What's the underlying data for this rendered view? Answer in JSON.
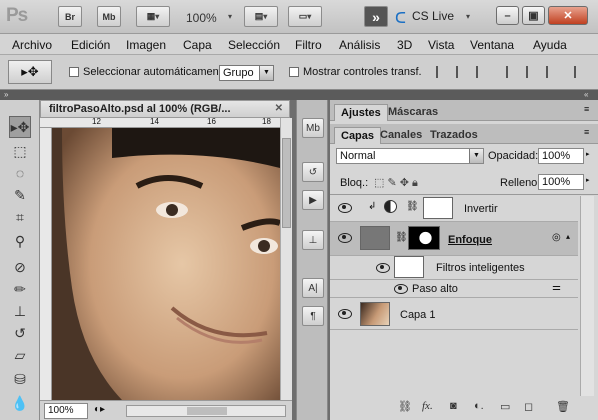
{
  "app": {
    "logo": "Ps",
    "bridge_btn": "Br",
    "minibridge_btn": "Mb",
    "zoom": "100%",
    "cslive": "CS Live",
    "workspace_arrow": "»"
  },
  "menu": [
    "Archivo",
    "Edición",
    "Imagen",
    "Capa",
    "Selección",
    "Filtro",
    "Análisis",
    "3D",
    "Vista",
    "Ventana",
    "Ayuda"
  ],
  "options": {
    "auto_select_label": "Seleccionar automáticamente:",
    "auto_select_value": "Grupo",
    "transform_label": "Mostrar controles transf."
  },
  "document": {
    "tab_title": "filtroPasoAlto.psd al 100% (RGB/...",
    "ruler_ticks": [
      "12",
      "14",
      "16",
      "18"
    ],
    "zoom_status": "100%"
  },
  "panels": {
    "top_tabs": [
      "Ajustes",
      "Máscaras"
    ],
    "layer_tabs": [
      "Capas",
      "Canales",
      "Trazados"
    ],
    "blend_mode": "Normal",
    "opacity_label": "Opacidad:",
    "opacity_value": "100%",
    "lock_label": "Bloq.:",
    "fill_label": "Relleno:",
    "fill_value": "100%",
    "layers": [
      {
        "name": "Invertir"
      },
      {
        "name": "Enfoque"
      },
      {
        "name": "Filtros inteligentes"
      },
      {
        "name": "Paso alto"
      },
      {
        "name": "Capa 1"
      }
    ]
  }
}
